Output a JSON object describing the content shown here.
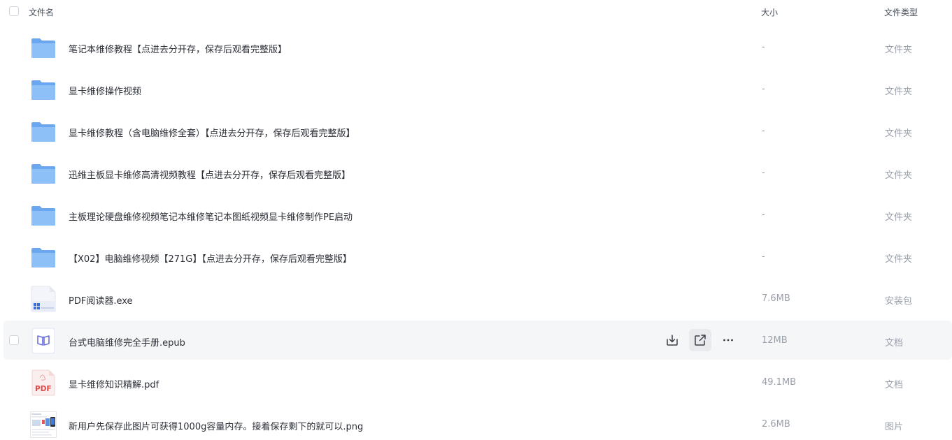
{
  "header": {
    "name_label": "文件名",
    "size_label": "大小",
    "type_label": "文件类型"
  },
  "rows": [
    {
      "name": "笔记本维修教程【点进去分开存，保存后观看完整版】",
      "size": "-",
      "type": "文件夹",
      "icon": "folder-icon"
    },
    {
      "name": "显卡维修操作视频",
      "size": "-",
      "type": "文件夹",
      "icon": "folder-icon"
    },
    {
      "name": "显卡维修教程（含电脑维修全套）【点进去分开存，保存后观看完整版】",
      "size": "-",
      "type": "文件夹",
      "icon": "folder-icon"
    },
    {
      "name": "迅维主板显卡维修高清视频教程【点进去分开存，保存后观看完整版】",
      "size": "-",
      "type": "文件夹",
      "icon": "folder-icon"
    },
    {
      "name": "主板理论硬盘维修视频笔记本维修笔记本图纸视频显卡维修制作PE启动",
      "size": "-",
      "type": "文件夹",
      "icon": "folder-icon"
    },
    {
      "name": "【X02】电脑维修视频【271G】【点进去分开存，保存后观看完整版】",
      "size": "-",
      "type": "文件夹",
      "icon": "folder-icon"
    },
    {
      "name": "PDF阅读器.exe",
      "size": "7.6MB",
      "type": "安装包",
      "icon": "exe-file-icon"
    },
    {
      "name": "台式电脑维修完全手册.epub",
      "size": "12MB",
      "type": "文档",
      "icon": "epub-book-icon"
    },
    {
      "name": "显卡维修知识精解.pdf",
      "size": "49.1MB",
      "type": "文档",
      "icon": "pdf-file-icon",
      "pdf_badge": "PDF"
    },
    {
      "name": "新用户先保存此图片可获得1000g容量内存。接着保存剩下的就可以.png",
      "size": "2.6MB",
      "type": "图片",
      "icon": "image-thumbnail-icon"
    }
  ],
  "row_actions": {
    "download": "download-icon",
    "share": "share-icon",
    "more": "more-icon"
  },
  "colors": {
    "folder": "#6aaaf0",
    "hover_row": "#f5f6f8",
    "pdf": "#e34b4b",
    "epub": "#6a6fe0"
  }
}
